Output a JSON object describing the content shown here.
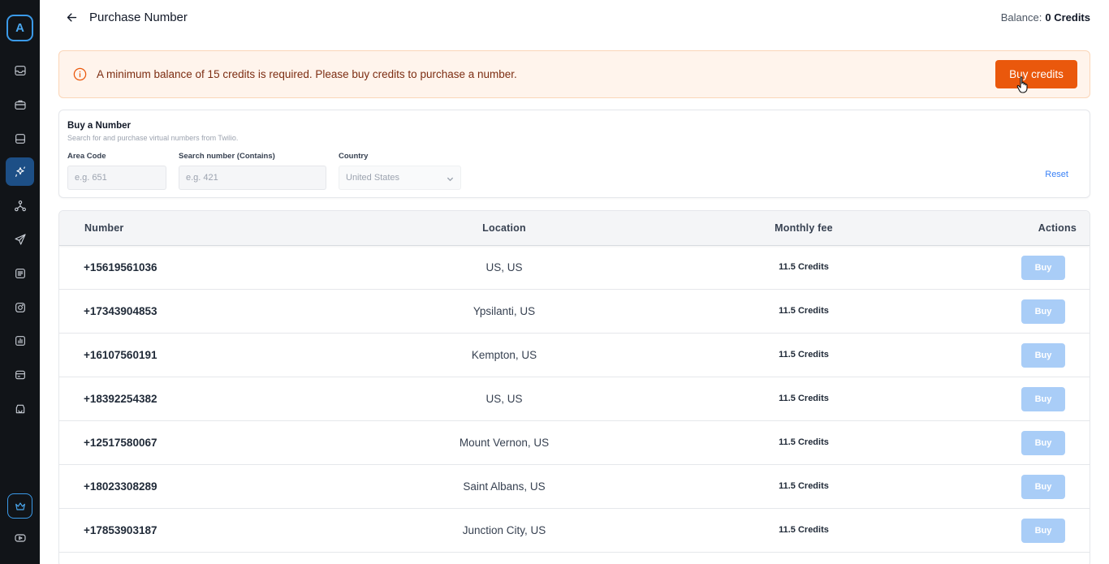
{
  "sidebar": {
    "logo_letter": "A",
    "items": [
      {
        "icon": "inbox-icon"
      },
      {
        "icon": "briefcase-icon"
      },
      {
        "icon": "database-icon"
      },
      {
        "icon": "sparkles-icon"
      },
      {
        "icon": "hierarchy-icon"
      },
      {
        "icon": "send-icon"
      },
      {
        "icon": "list-icon"
      },
      {
        "icon": "instagram-icon"
      },
      {
        "icon": "chart-icon"
      },
      {
        "icon": "card-icon"
      },
      {
        "icon": "shop-icon"
      },
      {
        "icon": "crown-icon"
      },
      {
        "icon": "youtube-icon"
      }
    ]
  },
  "header": {
    "title": "Purchase Number",
    "balance_label": "Balance:",
    "balance_value": "0 Credits"
  },
  "alert": {
    "message": "A minimum balance of 15 credits is required. Please buy credits to purchase a number.",
    "button_label": "Buy credits"
  },
  "search": {
    "title": "Buy a Number",
    "subtitle": "Search for and purchase virtual numbers from Twilio.",
    "area_code_label": "Area Code",
    "area_code_placeholder": "e.g. 651",
    "contains_label": "Search number (Contains)",
    "contains_placeholder": "e.g. 421",
    "country_label": "Country",
    "country_value": "United States",
    "reset_label": "Reset"
  },
  "table": {
    "columns": [
      "Number",
      "Location",
      "Monthly fee",
      "Actions"
    ],
    "rows": [
      {
        "number": "+15619561036",
        "location": "US, US",
        "fee": "11.5 Credits",
        "action": "Buy"
      },
      {
        "number": "+17343904853",
        "location": "Ypsilanti, US",
        "fee": "11.5 Credits",
        "action": "Buy"
      },
      {
        "number": "+16107560191",
        "location": "Kempton, US",
        "fee": "11.5 Credits",
        "action": "Buy"
      },
      {
        "number": "+18392254382",
        "location": "US, US",
        "fee": "11.5 Credits",
        "action": "Buy"
      },
      {
        "number": "+12517580067",
        "location": "Mount Vernon, US",
        "fee": "11.5 Credits",
        "action": "Buy"
      },
      {
        "number": "+18023308289",
        "location": "Saint Albans, US",
        "fee": "11.5 Credits",
        "action": "Buy"
      },
      {
        "number": "+17853903187",
        "location": "Junction City, US",
        "fee": "11.5 Credits",
        "action": "Buy"
      }
    ]
  },
  "colors": {
    "accent": "#ea580c",
    "sidebar_bg": "#111418",
    "active_nav": "#1d4f86",
    "buy_disabled": "#a9cdf7"
  }
}
